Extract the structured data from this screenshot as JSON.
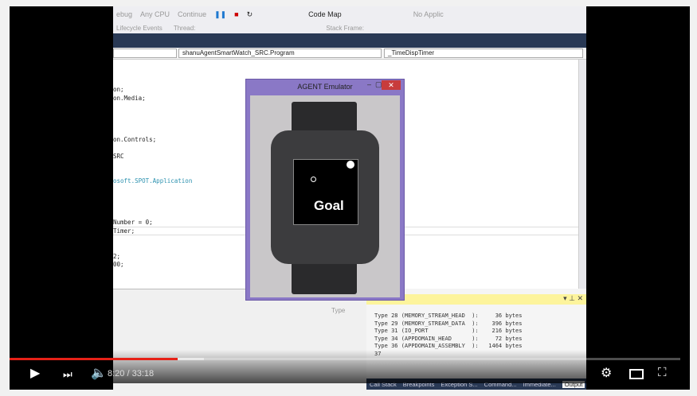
{
  "vs": {
    "toolbar1": [
      "ebug",
      "Any CPU",
      "Continue",
      "Code Map",
      "No Applic"
    ],
    "toolbar2": [
      "Lifecycle Events",
      "Thread:",
      "Stack Frame:"
    ],
    "nav": {
      "class": "shanuAgentSmartWatch_SRC.Program",
      "member": "_TimeDispTimer"
    },
    "code_lines": [
      "on;",
      "on.Media;",
      "on.Controls;",
      "SRC",
      "osoft.SPOT.Application",
      "Number = 0;",
      "Timer;",
      "2;",
      "00;"
    ],
    "lower_header": "Type",
    "output_lines": [
      "Type 28 (MEMORY_STREAM_HEAD  ):     36 bytes",
      "Type 29 (MEMORY_STREAM_DATA  ):    396 bytes",
      "Type 31 (IO_PORT             ):    216 bytes",
      "Type 34 (APPDOMAIN_HEAD      ):     72 bytes",
      "Type 36 (APPDOMAIN_ASSEMBLY  ):   1464 bytes",
      "37"
    ],
    "bottom_tabs": [
      "Call Stack",
      "Breakpoints",
      "Exception S...",
      "Command...",
      "Immediate...",
      "Output"
    ]
  },
  "emulator": {
    "title": "AGENT Emulator",
    "screen_text": "Goal"
  },
  "player": {
    "current_time": "8:20",
    "duration": "33:18",
    "time_display": "8:20 / 33:18",
    "progress_fraction": 0.25,
    "buffered_fraction": 0.29,
    "accent": "#e62117"
  }
}
